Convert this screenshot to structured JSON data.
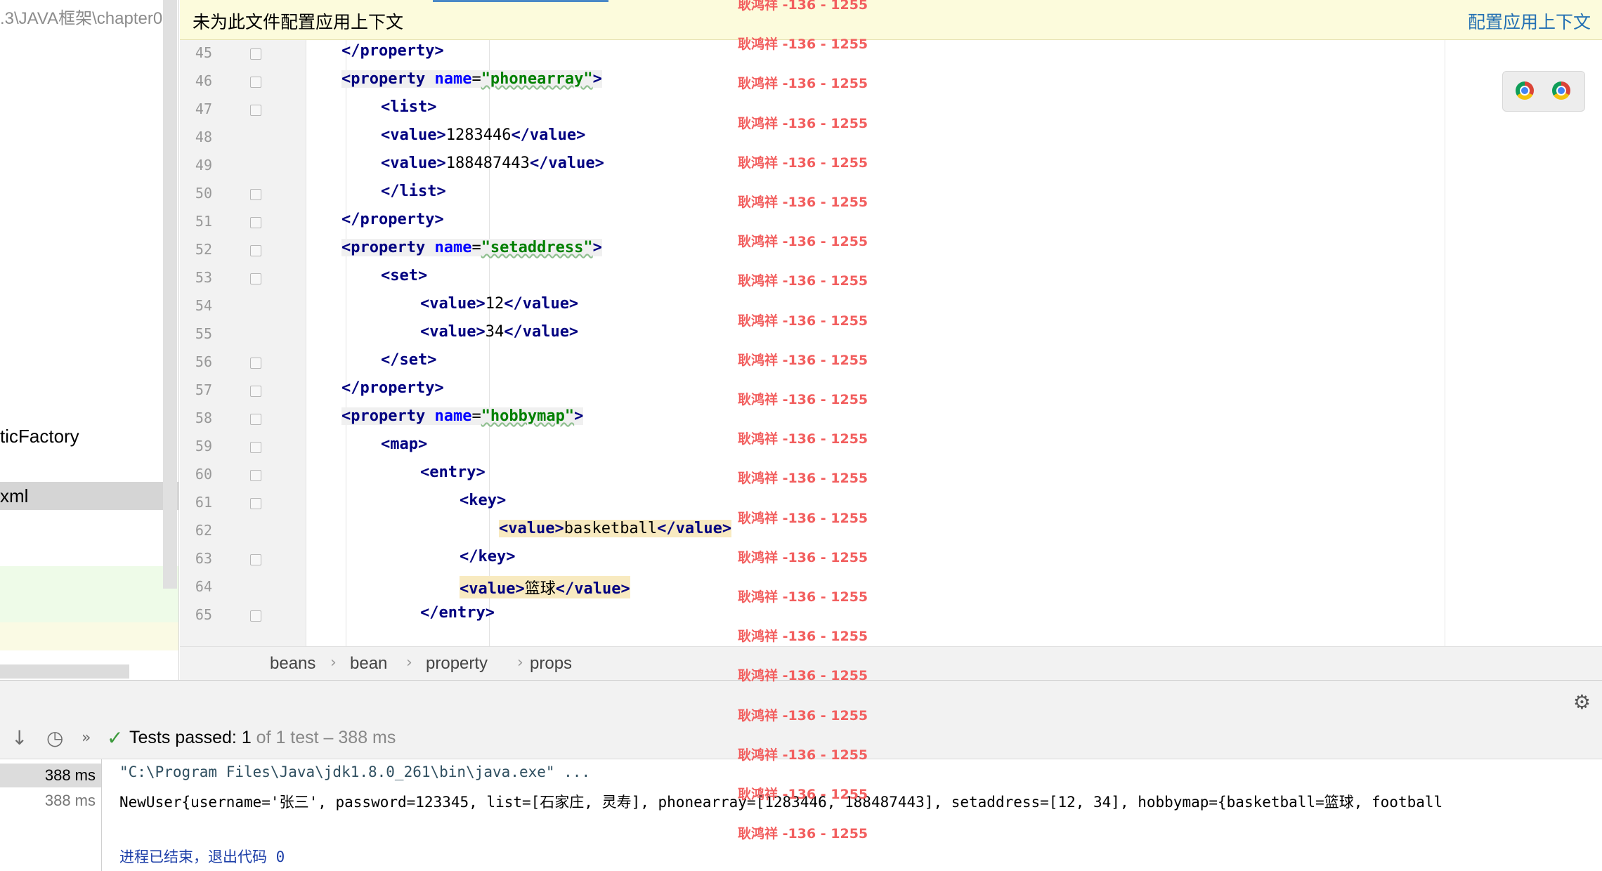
{
  "project_panel": {
    "path_text": ".3\\JAVA框架\\chapter0",
    "item_factory": "ticFactory",
    "item_xml": "xml"
  },
  "banner": {
    "message": "未为此文件配置应用上下文",
    "action_link": "配置应用上下文"
  },
  "editor": {
    "lines": [
      {
        "num": "45",
        "indent": 0,
        "segs": [
          {
            "c": "t",
            "v": "</property>"
          }
        ]
      },
      {
        "num": "46",
        "indent": 0,
        "segs": [
          {
            "c": "t",
            "v": "<property "
          },
          {
            "c": "attr",
            "v": "name"
          },
          {
            "c": "",
            "v": "="
          },
          {
            "c": "str",
            "v": "\"phonearray\""
          },
          {
            "c": "t",
            "v": ">"
          }
        ],
        "box": true
      },
      {
        "num": "47",
        "indent": 1,
        "segs": [
          {
            "c": "t",
            "v": "<list>"
          }
        ]
      },
      {
        "num": "48",
        "indent": 1,
        "segs": [
          {
            "c": "t",
            "v": "<value>"
          },
          {
            "c": "",
            "v": "1283446"
          },
          {
            "c": "t",
            "v": "</value>"
          }
        ]
      },
      {
        "num": "49",
        "indent": 1,
        "segs": [
          {
            "c": "t",
            "v": "<value>"
          },
          {
            "c": "",
            "v": "188487443"
          },
          {
            "c": "t",
            "v": "</value>"
          }
        ]
      },
      {
        "num": "50",
        "indent": 1,
        "segs": [
          {
            "c": "t",
            "v": "</list>"
          }
        ]
      },
      {
        "num": "51",
        "indent": 0,
        "segs": [
          {
            "c": "t",
            "v": "</property>"
          }
        ]
      },
      {
        "num": "52",
        "indent": 0,
        "segs": [
          {
            "c": "t",
            "v": "<property "
          },
          {
            "c": "attr",
            "v": "name"
          },
          {
            "c": "",
            "v": "="
          },
          {
            "c": "str",
            "v": "\"setaddress\""
          },
          {
            "c": "t",
            "v": ">"
          }
        ],
        "box": true
      },
      {
        "num": "53",
        "indent": 1,
        "segs": [
          {
            "c": "t",
            "v": "<set>"
          }
        ]
      },
      {
        "num": "54",
        "indent": 2,
        "segs": [
          {
            "c": "t",
            "v": "<value>"
          },
          {
            "c": "",
            "v": "12"
          },
          {
            "c": "t",
            "v": "</value>"
          }
        ]
      },
      {
        "num": "55",
        "indent": 2,
        "segs": [
          {
            "c": "t",
            "v": "<value>"
          },
          {
            "c": "",
            "v": "34"
          },
          {
            "c": "t",
            "v": "</value>"
          }
        ]
      },
      {
        "num": "56",
        "indent": 1,
        "segs": [
          {
            "c": "t",
            "v": "</set>"
          }
        ]
      },
      {
        "num": "57",
        "indent": 0,
        "segs": [
          {
            "c": "t",
            "v": "</property>"
          }
        ]
      },
      {
        "num": "58",
        "indent": 0,
        "segs": [
          {
            "c": "t",
            "v": "<property "
          },
          {
            "c": "attr",
            "v": "name"
          },
          {
            "c": "",
            "v": "="
          },
          {
            "c": "str",
            "v": "\"hobbymap\""
          },
          {
            "c": "t",
            "v": ">"
          }
        ],
        "box": true
      },
      {
        "num": "59",
        "indent": 1,
        "segs": [
          {
            "c": "t",
            "v": "<map>"
          }
        ]
      },
      {
        "num": "60",
        "indent": 2,
        "segs": [
          {
            "c": "t",
            "v": "<entry>"
          }
        ]
      },
      {
        "num": "61",
        "indent": 3,
        "segs": [
          {
            "c": "t",
            "v": "<key>"
          }
        ]
      },
      {
        "num": "62",
        "indent": 4,
        "segs": [
          {
            "c": "t",
            "v": "<value>"
          },
          {
            "c": "",
            "v": "basketball"
          },
          {
            "c": "t",
            "v": "</value>"
          }
        ],
        "hl": true
      },
      {
        "num": "63",
        "indent": 3,
        "segs": [
          {
            "c": "t",
            "v": "</key>"
          }
        ]
      },
      {
        "num": "64",
        "indent": 3,
        "segs": [
          {
            "c": "t",
            "v": "<value>"
          },
          {
            "c": "",
            "v": "篮球"
          },
          {
            "c": "t",
            "v": "</value>"
          }
        ],
        "hl": true
      },
      {
        "num": "65",
        "indent": 2,
        "segs": [
          {
            "c": "t",
            "v": "</entry>"
          }
        ]
      }
    ]
  },
  "breadcrumb": [
    "beans",
    "bean",
    "property",
    "props"
  ],
  "test_bar": {
    "label": "Tests passed: ",
    "passed": "1",
    "rest": " of 1 test – 388 ms"
  },
  "console": {
    "time1": "388 ms",
    "time2": "388 ms",
    "line1": "\"C:\\Program Files\\Java\\jdk1.8.0_261\\bin\\java.exe\" ...",
    "line2": "NewUser{username='张三', password=123345, list=[石家庄, 灵寿], phonearray=[1283446, 188487443], setaddress=[12, 34], hobbymap={basketball=篮球, football",
    "line3": "进程已结束，退出代码 0"
  },
  "watermark": {
    "text": "耿鸿祥 -136 - 1255",
    "repeat": 22
  },
  "colors": {
    "tag": "#000080",
    "attr": "#0000ff",
    "string": "#008000",
    "watermark": "#f25f5f",
    "link": "#2470b3"
  },
  "icons": [
    "gear-icon",
    "sort-down-icon",
    "history-icon",
    "double-chevron-icon",
    "check-icon",
    "chrome-icon"
  ]
}
